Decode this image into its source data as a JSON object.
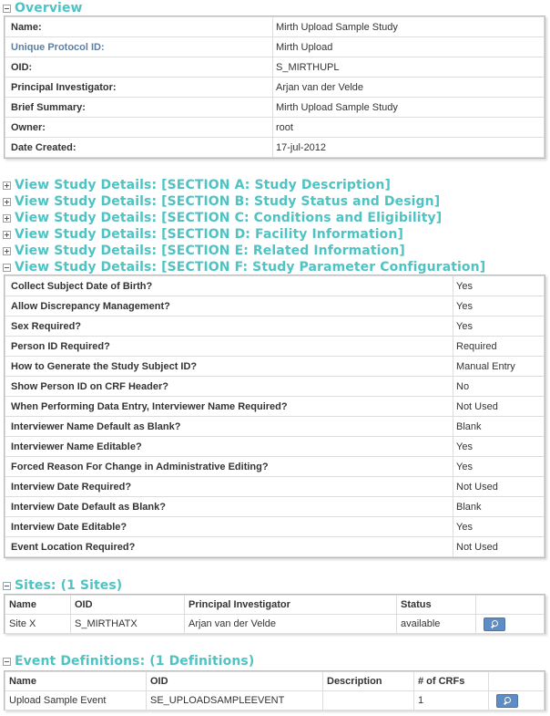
{
  "overview": {
    "title": "Overview",
    "rows": [
      {
        "label": "Name:",
        "value": "Mirth Upload Sample Study"
      },
      {
        "label": "Unique Protocol ID:",
        "value": "Mirth Upload"
      },
      {
        "label": "OID:",
        "value": "S_MIRTHUPL"
      },
      {
        "label": "Principal Investigator:",
        "value": "Arjan van der Velde"
      },
      {
        "label": "Brief Summary:",
        "value": "Mirth Upload Sample Study"
      },
      {
        "label": "Owner:",
        "value": "root"
      },
      {
        "label": "Date Created:",
        "value": "17-jul-2012"
      }
    ]
  },
  "details_sections": [
    "View Study Details: [SECTION A: Study Description]",
    "View Study Details: [SECTION B: Study Status and Design]",
    "View Study Details: [SECTION C: Conditions and Eligibility]",
    "View Study Details: [SECTION D: Facility Information]",
    "View Study Details: [SECTION E: Related Information]",
    "View Study Details: [SECTION F: Study Parameter Configuration]"
  ],
  "parameters": [
    {
      "label": "Collect Subject Date of Birth?",
      "value": "Yes"
    },
    {
      "label": "Allow Discrepancy Management?",
      "value": "Yes"
    },
    {
      "label": "Sex Required?",
      "value": "Yes"
    },
    {
      "label": "Person ID Required?",
      "value": "Required"
    },
    {
      "label": "How to Generate the Study Subject ID?",
      "value": "Manual Entry"
    },
    {
      "label": "Show Person ID on CRF Header?",
      "value": "No"
    },
    {
      "label": "When Performing Data Entry, Interviewer Name Required?",
      "value": "Not Used"
    },
    {
      "label": "Interviewer Name Default as Blank?",
      "value": "Blank"
    },
    {
      "label": "Interviewer Name Editable?",
      "value": "Yes"
    },
    {
      "label": "Forced Reason For Change in Administrative Editing?",
      "value": "Yes"
    },
    {
      "label": "Interview Date Required?",
      "value": "Not Used"
    },
    {
      "label": "Interview Date Default as Blank?",
      "value": "Blank"
    },
    {
      "label": "Interview Date Editable?",
      "value": "Yes"
    },
    {
      "label": "Event Location Required?",
      "value": "Not Used"
    }
  ],
  "sites": {
    "title": "Sites: (1 Sites)",
    "columns": [
      "Name",
      "OID",
      "Principal Investigator",
      "Status",
      ""
    ],
    "rows": [
      {
        "name": "Site X",
        "oid": "S_MIRTHATX",
        "pi": "Arjan van der Velde",
        "status": "available",
        "action_icon": "magnifier-icon"
      }
    ]
  },
  "events": {
    "title": "Event Definitions: (1 Definitions)",
    "columns": [
      "Name",
      "OID",
      "Description",
      "# of CRFs",
      ""
    ],
    "rows": [
      {
        "name": "Upload Sample Event",
        "oid": "SE_UPLOADSAMPLEEVENT",
        "description": "",
        "crfs": "1",
        "action_icon": "magnifier-icon"
      }
    ]
  },
  "colors": {
    "section_heading": "#4fc3c3",
    "link_label": "#5b7fa6",
    "view_button": "#5d8dc4"
  }
}
